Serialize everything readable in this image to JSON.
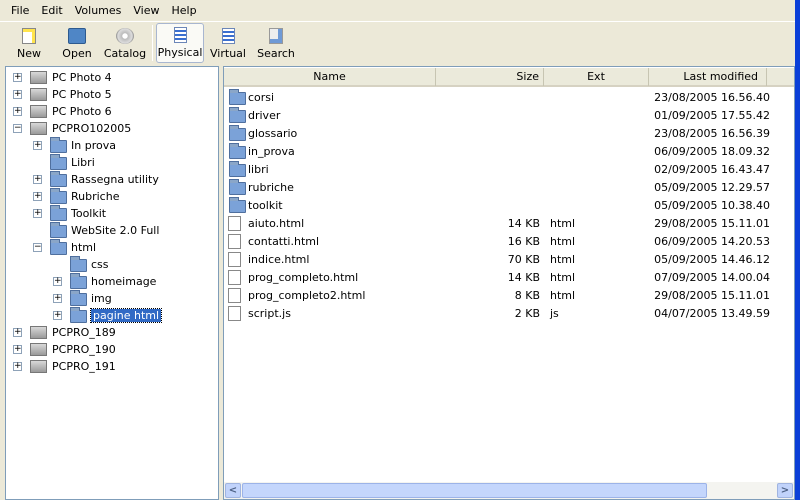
{
  "menu": [
    "File",
    "Edit",
    "Volumes",
    "View",
    "Help"
  ],
  "toolbar": [
    {
      "label": "New",
      "icon": "new-icon"
    },
    {
      "label": "Open",
      "icon": "open-icon"
    },
    {
      "label": "Catalog",
      "icon": "catalog-icon"
    },
    {
      "label": "Physical",
      "icon": "physical-icon",
      "active": true
    },
    {
      "label": "Virtual",
      "icon": "virtual-icon"
    },
    {
      "label": "Search",
      "icon": "search-icon"
    }
  ],
  "tree": [
    {
      "label": "PC Photo 4",
      "type": "drive",
      "level": 0,
      "expander": "+"
    },
    {
      "label": "PC Photo 5",
      "type": "drive",
      "level": 0,
      "expander": "+"
    },
    {
      "label": "PC Photo 6",
      "type": "drive",
      "level": 0,
      "expander": "+"
    },
    {
      "label": "PCPRO102005",
      "type": "drive",
      "level": 0,
      "expander": "-"
    },
    {
      "label": "In prova",
      "type": "folder",
      "level": 1,
      "expander": "+"
    },
    {
      "label": "Libri",
      "type": "folder",
      "level": 1,
      "expander": ""
    },
    {
      "label": "Rassegna utility",
      "type": "folder",
      "level": 1,
      "expander": "+"
    },
    {
      "label": "Rubriche",
      "type": "folder",
      "level": 1,
      "expander": "+"
    },
    {
      "label": "Toolkit",
      "type": "folder",
      "level": 1,
      "expander": "+"
    },
    {
      "label": "WebSite 2.0 Full",
      "type": "folder",
      "level": 1,
      "expander": ""
    },
    {
      "label": "html",
      "type": "folder",
      "level": 1,
      "expander": "-"
    },
    {
      "label": "css",
      "type": "folder",
      "level": 2,
      "expander": ""
    },
    {
      "label": "homeimage",
      "type": "folder",
      "level": 2,
      "expander": "+"
    },
    {
      "label": "img",
      "type": "folder",
      "level": 2,
      "expander": "+"
    },
    {
      "label": "pagine html",
      "type": "folder",
      "level": 2,
      "expander": "+",
      "selected": true
    },
    {
      "label": "PCPRO_189",
      "type": "drive",
      "level": 0,
      "expander": "+"
    },
    {
      "label": "PCPRO_190",
      "type": "drive",
      "level": 0,
      "expander": "+"
    },
    {
      "label": "PCPRO_191",
      "type": "drive",
      "level": 0,
      "expander": "+"
    }
  ],
  "columns": {
    "name": "Name",
    "size": "Size",
    "ext": "Ext",
    "modified": "Last modified"
  },
  "files": [
    {
      "name": "corsi",
      "size": "",
      "ext": "",
      "modified": "23/08/2005 16.56.40",
      "type": "folder"
    },
    {
      "name": "driver",
      "size": "",
      "ext": "",
      "modified": "01/09/2005 17.55.42",
      "type": "folder"
    },
    {
      "name": "glossario",
      "size": "",
      "ext": "",
      "modified": "23/08/2005 16.56.39",
      "type": "folder"
    },
    {
      "name": "in_prova",
      "size": "",
      "ext": "",
      "modified": "06/09/2005 18.09.32",
      "type": "folder"
    },
    {
      "name": "libri",
      "size": "",
      "ext": "",
      "modified": "02/09/2005 16.43.47",
      "type": "folder"
    },
    {
      "name": "rubriche",
      "size": "",
      "ext": "",
      "modified": "05/09/2005 12.29.57",
      "type": "folder"
    },
    {
      "name": "toolkit",
      "size": "",
      "ext": "",
      "modified": "05/09/2005 10.38.40",
      "type": "folder"
    },
    {
      "name": "aiuto.html",
      "size": "14 KB",
      "ext": "html",
      "modified": "29/08/2005 15.11.01",
      "type": "file"
    },
    {
      "name": "contatti.html",
      "size": "16 KB",
      "ext": "html",
      "modified": "06/09/2005 14.20.53",
      "type": "file"
    },
    {
      "name": "indice.html",
      "size": "70 KB",
      "ext": "html",
      "modified": "05/09/2005 14.46.12",
      "type": "file"
    },
    {
      "name": "prog_completo.html",
      "size": "14 KB",
      "ext": "html",
      "modified": "07/09/2005 14.00.04",
      "type": "file"
    },
    {
      "name": "prog_completo2.html",
      "size": "8 KB",
      "ext": "html",
      "modified": "29/08/2005 15.11.01",
      "type": "file"
    },
    {
      "name": "script.js",
      "size": "2 KB",
      "ext": "js",
      "modified": "04/07/2005 13.49.59",
      "type": "file"
    }
  ],
  "scrollbar": {
    "horizontal_position": 0,
    "visible_fraction": 0.87
  }
}
